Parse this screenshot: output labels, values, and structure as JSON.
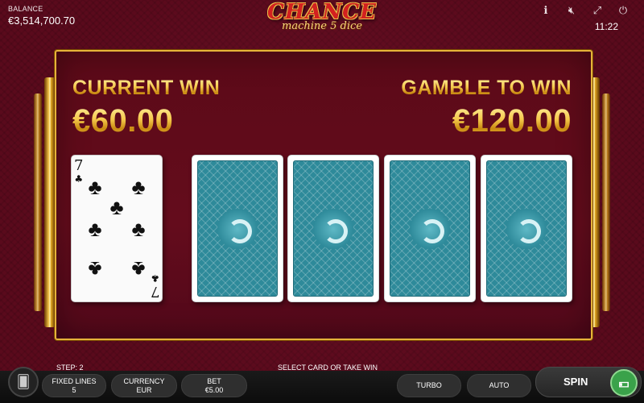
{
  "header": {
    "balance_label": "BALANCE",
    "balance_value": "€3,514,700.70",
    "logo_line1": "CHANCE",
    "logo_line2": "machine 5 dice",
    "clock": "11:22",
    "icons": [
      "info-icon",
      "mute-icon",
      "fullscreen-icon",
      "power-icon"
    ]
  },
  "gamble": {
    "current_win_label": "CURRENT WIN",
    "current_win_value": "€60.00",
    "gamble_to_win_label": "GAMBLE TO WIN",
    "gamble_to_win_value": "€120.00",
    "dealer_card": {
      "rank": "7",
      "suit": "♣",
      "suit_name": "clubs"
    },
    "face_down_cards": 4
  },
  "footer": {
    "step": "STEP: 2",
    "message": "SELECT CARD OR TAKE WIN",
    "fixed_lines_label": "FIXED LINES",
    "fixed_lines_value": "5",
    "currency_label": "CURRENCY",
    "currency_value": "EUR",
    "bet_label": "BET",
    "bet_value": "€5.00",
    "turbo_label": "TURBO",
    "auto_label": "AUTO",
    "spin_label": "SPIN"
  },
  "colors": {
    "background": "#5a0a1c",
    "gold": "#f5c84a",
    "card_back": "#2e8a9a",
    "spin_money": "#3aa24a"
  }
}
